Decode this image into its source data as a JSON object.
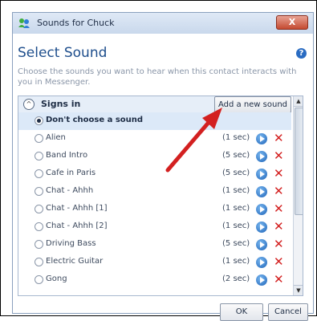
{
  "window": {
    "title": "Sounds for Chuck",
    "close_label": "X"
  },
  "dialog": {
    "heading": "Select Sound",
    "help_label": "?",
    "description": "Choose the sounds you want to hear when this contact interacts with you in Messenger."
  },
  "group": {
    "label": "Signs in",
    "add_button": "Add a new sound",
    "collapse_label": "^"
  },
  "sounds": [
    {
      "label": "Don't choose a sound",
      "duration": "",
      "selected": true
    },
    {
      "label": "Alien",
      "duration": "(1 sec)"
    },
    {
      "label": "Band Intro",
      "duration": "(5 sec)"
    },
    {
      "label": "Cafe in Paris",
      "duration": "(5 sec)"
    },
    {
      "label": "Chat - Ahhh",
      "duration": "(1 sec)"
    },
    {
      "label": "Chat - Ahhh [1]",
      "duration": "(1 sec)"
    },
    {
      "label": "Chat - Ahhh [2]",
      "duration": "(1 sec)"
    },
    {
      "label": "Driving Bass",
      "duration": "(5 sec)"
    },
    {
      "label": "Electric Guitar",
      "duration": "(1 sec)"
    },
    {
      "label": "Gong",
      "duration": "(2 sec)"
    }
  ],
  "buttons": {
    "ok": "OK",
    "cancel": "Cancel"
  },
  "colors": {
    "accent": "#1e4e8c",
    "arrow": "#d32020",
    "delete": "#d32020"
  }
}
